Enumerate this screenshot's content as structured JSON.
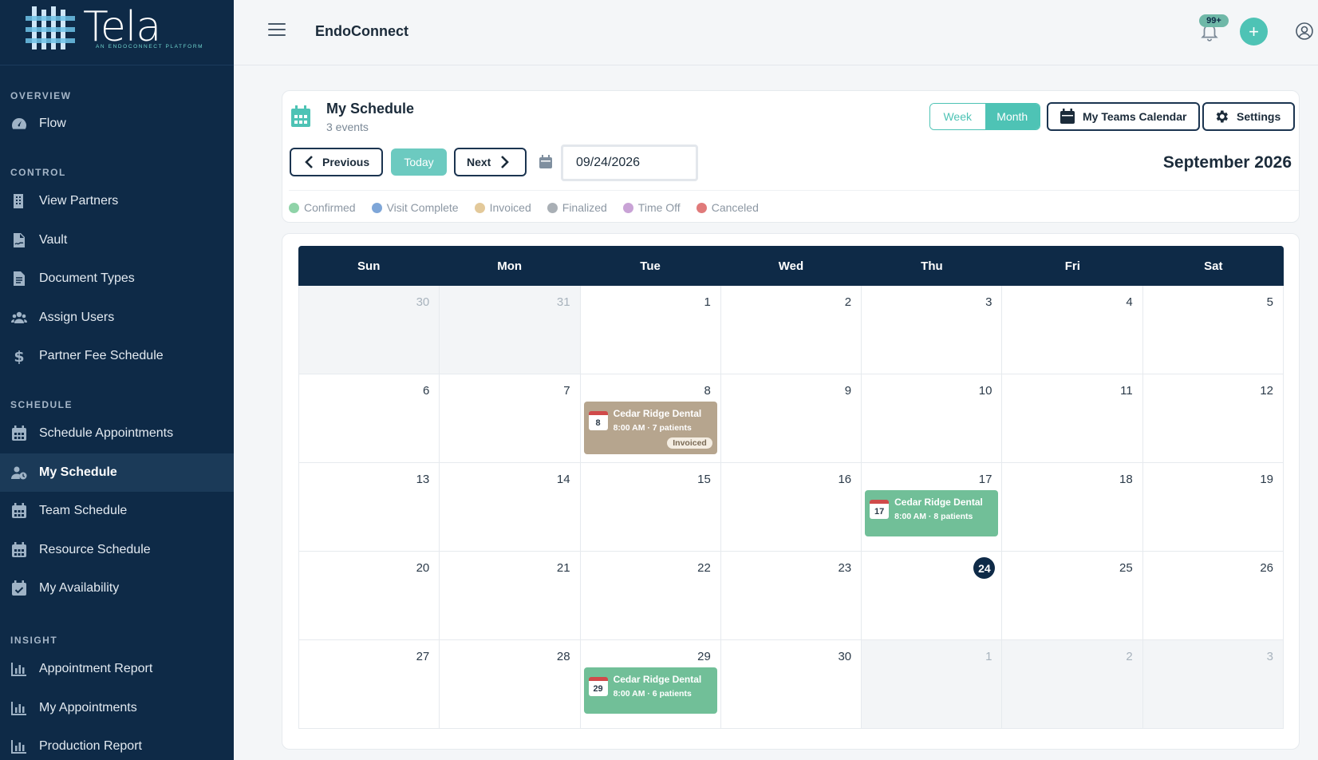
{
  "brand": {
    "logo_text": "Tela",
    "logo_sub": "AN ENDOCONNECT PLATFORM"
  },
  "sidebar": {
    "sections": [
      {
        "label": "OVERVIEW",
        "items": [
          {
            "label": "Flow",
            "icon": "gauge-icon"
          }
        ]
      },
      {
        "label": "CONTROL",
        "items": [
          {
            "label": "View Partners",
            "icon": "building-icon"
          },
          {
            "label": "Vault",
            "icon": "file-signature-icon"
          },
          {
            "label": "Document Types",
            "icon": "file-icon"
          },
          {
            "label": "Assign Users",
            "icon": "users-icon"
          },
          {
            "label": "Partner Fee Schedule",
            "icon": "dollar-icon"
          }
        ]
      },
      {
        "label": "SCHEDULE",
        "items": [
          {
            "label": "Schedule Appointments",
            "icon": "calendar-icon"
          },
          {
            "label": "My Schedule",
            "icon": "user-clock-icon",
            "active": true
          },
          {
            "label": "Team Schedule",
            "icon": "calendar-icon"
          },
          {
            "label": "Resource Schedule",
            "icon": "calendar-icon"
          },
          {
            "label": "My Availability",
            "icon": "calendar-check-icon"
          }
        ]
      },
      {
        "label": "INSIGHT",
        "items": [
          {
            "label": "Appointment Report",
            "icon": "bar-chart-icon"
          },
          {
            "label": "My Appointments",
            "icon": "bar-chart-icon"
          },
          {
            "label": "Production Report",
            "icon": "bar-chart-icon"
          }
        ]
      }
    ]
  },
  "header": {
    "app_title": "EndoConnect",
    "notification_badge": "99+",
    "add_label": "+"
  },
  "schedule": {
    "title": "My Schedule",
    "subtitle": "3 events",
    "view_week": "Week",
    "view_month": "Month",
    "active_view": "Month",
    "teams_calendar_label": "My Teams Calendar",
    "settings_label": "Settings",
    "previous_label": "Previous",
    "today_label": "Today",
    "next_label": "Next",
    "date_value": "09/24/2026",
    "month_label": "September 2026",
    "legend": [
      {
        "label": "Confirmed",
        "color": "#8fd3a8"
      },
      {
        "label": "Visit Complete",
        "color": "#7ea6d8"
      },
      {
        "label": "Invoiced",
        "color": "#e3c99a"
      },
      {
        "label": "Finalized",
        "color": "#a9afb5"
      },
      {
        "label": "Time Off",
        "color": "#c9a3d6"
      },
      {
        "label": "Canceled",
        "color": "#e07a7a"
      }
    ]
  },
  "calendar": {
    "weekdays": [
      "Sun",
      "Mon",
      "Tue",
      "Wed",
      "Thu",
      "Fri",
      "Sat"
    ],
    "weeks": [
      [
        {
          "day": "30",
          "other": true
        },
        {
          "day": "31",
          "other": true
        },
        {
          "day": "1"
        },
        {
          "day": "2"
        },
        {
          "day": "3"
        },
        {
          "day": "4"
        },
        {
          "day": "5"
        }
      ],
      [
        {
          "day": "6"
        },
        {
          "day": "7"
        },
        {
          "day": "8",
          "event": {
            "title": "Cedar Ridge Dental",
            "meta": "8:00 AM · 7 patients",
            "status": "invoiced",
            "tag": "Invoiced"
          }
        },
        {
          "day": "9"
        },
        {
          "day": "10"
        },
        {
          "day": "11"
        },
        {
          "day": "12"
        }
      ],
      [
        {
          "day": "13"
        },
        {
          "day": "14"
        },
        {
          "day": "15"
        },
        {
          "day": "16"
        },
        {
          "day": "17",
          "event": {
            "title": "Cedar Ridge Dental",
            "meta": "8:00 AM · 8 patients",
            "status": "confirmed"
          }
        },
        {
          "day": "18"
        },
        {
          "day": "19"
        }
      ],
      [
        {
          "day": "20"
        },
        {
          "day": "21"
        },
        {
          "day": "22"
        },
        {
          "day": "23"
        },
        {
          "day": "24",
          "today": true
        },
        {
          "day": "25"
        },
        {
          "day": "26"
        }
      ],
      [
        {
          "day": "27"
        },
        {
          "day": "28"
        },
        {
          "day": "29",
          "event": {
            "title": "Cedar Ridge Dental",
            "meta": "8:00 AM · 6 patients",
            "status": "confirmed"
          }
        },
        {
          "day": "30"
        },
        {
          "day": "1",
          "other": true
        },
        {
          "day": "2",
          "other": true
        },
        {
          "day": "3",
          "other": true
        }
      ]
    ]
  }
}
